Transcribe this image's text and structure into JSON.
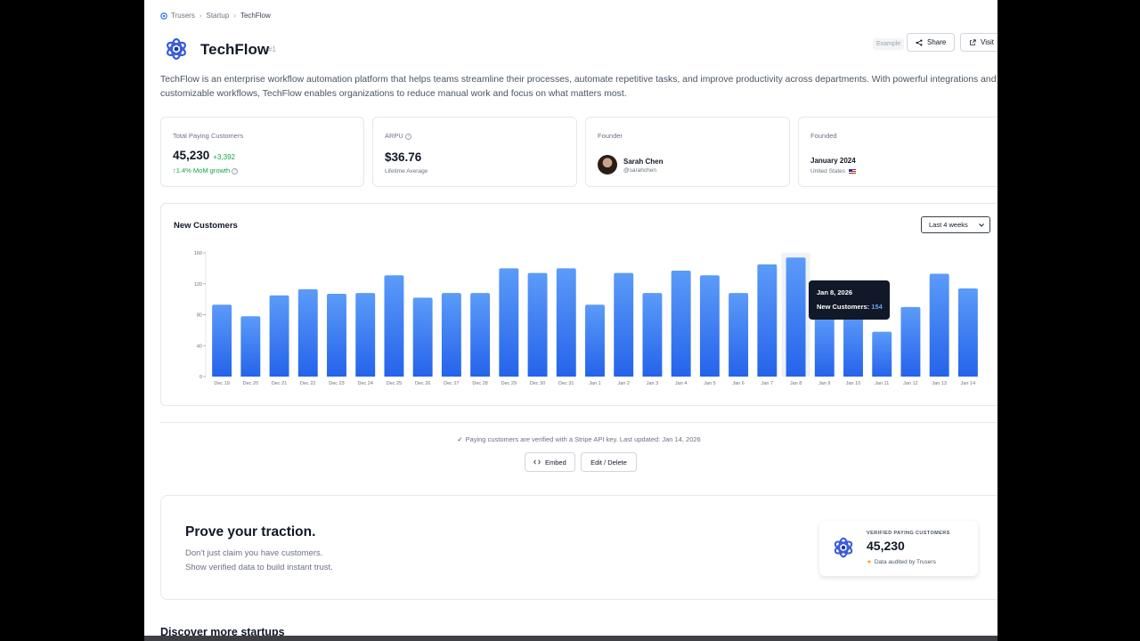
{
  "breadcrumb": {
    "root": "Trusers",
    "section": "Startup",
    "current": "TechFlow"
  },
  "header": {
    "title": "TechFlow",
    "rank": "#1",
    "example_label": "Example",
    "share_label": "Share",
    "visit_label": "Visit",
    "logo_icon": "techflow-logo-icon"
  },
  "description": "TechFlow is an enterprise workflow automation platform that helps teams streamline their processes, automate repetitive tasks, and improve productivity across departments. With powerful integrations and customizable workflows, TechFlow enables organizations to reduce manual work and focus on what matters most.",
  "stats": {
    "customers": {
      "label": "Total Paying Customers",
      "value": "45,230",
      "delta": "+3,392",
      "growth": "↑1.4% MoM growth"
    },
    "arpu": {
      "label": "ARPU",
      "value": "$36.76",
      "sub": "Lifetime Average"
    },
    "founder": {
      "label": "Founder",
      "name": "Sarah Chen",
      "handle": "@sarahchen"
    },
    "founded": {
      "label": "Founded",
      "date": "January 2024",
      "location": "United States"
    }
  },
  "chart_panel": {
    "title": "New Customers",
    "range_selected": "Last 4 weeks",
    "tooltip": {
      "date": "Jan 8, 2026",
      "label": "New Customers:",
      "value": "154"
    }
  },
  "chart_data": {
    "type": "bar",
    "categories": [
      "Dec 19",
      "Dec 20",
      "Dec 21",
      "Dec 22",
      "Dec 23",
      "Dec 24",
      "Dec 25",
      "Dec 26",
      "Dec 27",
      "Dec 28",
      "Dec 29",
      "Dec 30",
      "Dec 31",
      "Jan 1",
      "Jan 2",
      "Jan 3",
      "Jan 4",
      "Jan 5",
      "Jan 6",
      "Jan 7",
      "Jan 8",
      "Jan 9",
      "Jan 10",
      "Jan 11",
      "Jan 12",
      "Jan 13",
      "Jan 14"
    ],
    "values": [
      93,
      78,
      105,
      113,
      107,
      108,
      131,
      102,
      108,
      108,
      140,
      134,
      140,
      93,
      134,
      108,
      137,
      131,
      108,
      145,
      154,
      78,
      80,
      58,
      90,
      133,
      114
    ],
    "ylim": [
      0,
      160
    ],
    "yticks": [
      0,
      40,
      80,
      120,
      160
    ],
    "highlight_index": 20,
    "bar_color": "#3b82f6",
    "grid": false
  },
  "verification": {
    "note": "Paying customers are verified with a Stripe API key. Last updated: Jan 14, 2026",
    "embed_label": "Embed",
    "edit_label": "Edit / Delete"
  },
  "promo": {
    "title": "Prove your traction.",
    "line1": "Don't just claim you have customers.",
    "line2": "Show verified data to build instant trust.",
    "badge_label": "VERIFIED PAYING CUSTOMERS",
    "badge_value": "45,230",
    "badge_audit": "Data audited by Trusers"
  },
  "discover": {
    "title": "Discover more startups"
  }
}
